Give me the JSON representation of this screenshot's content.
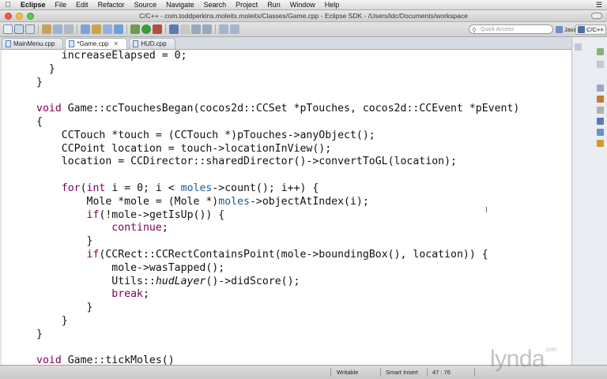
{
  "menubar": {
    "app": "Eclipse",
    "items": [
      "File",
      "Edit",
      "Refactor",
      "Source",
      "Navigate",
      "Search",
      "Project",
      "Run",
      "Window",
      "Help"
    ]
  },
  "window": {
    "title": "C/C++ - com.toddperkins.moleitx.moleitx/Classes/Game.cpp - Eclipse SDK - /Users/ldc/Documents/workspace"
  },
  "toolbar": {
    "quick_access_placeholder": "Quick Access",
    "perspectives": [
      "Java",
      "C/C++"
    ]
  },
  "tabs": [
    {
      "label": "MainMenu.cpp",
      "active": false
    },
    {
      "label": "*Game.cpp",
      "active": true
    },
    {
      "label": "HUD.cpp",
      "active": false
    }
  ],
  "code": {
    "lines": [
      "    increaseElapsed = 0;",
      "  }",
      "}",
      "",
      "void Game::ccTouchesBegan(cocos2d::CCSet *pTouches, cocos2d::CCEvent *pEvent)",
      "{",
      "    CCTouch *touch = (CCTouch *)pTouches->anyObject();",
      "    CCPoint location = touch->locationInView();",
      "    location = CCDirector::sharedDirector()->convertToGL(location);",
      "",
      "    for(int i = 0; i < moles->count(); i++) {",
      "        Mole *mole = (Mole *)moles->objectAtIndex(i);",
      "        if(!mole->getIsUp()) {",
      "            continue;",
      "        }",
      "        if(CCRect::CCRectContainsPoint(mole->boundingBox(), location)) {",
      "            mole->wasTapped();",
      "            Utils::hudLayer()->didScore();",
      "            break;",
      "        }",
      "    }",
      "}",
      "",
      "void Game::tickMoles()"
    ]
  },
  "status": {
    "writable": "Writable",
    "insert_mode": "Smart Insert",
    "position": "47 : 76"
  },
  "watermark": {
    "brand": "lynda",
    "tld": ".com"
  },
  "colors": {
    "keyword": "#7f0055",
    "field": "#1d5b8f",
    "background": "#ffffff"
  }
}
